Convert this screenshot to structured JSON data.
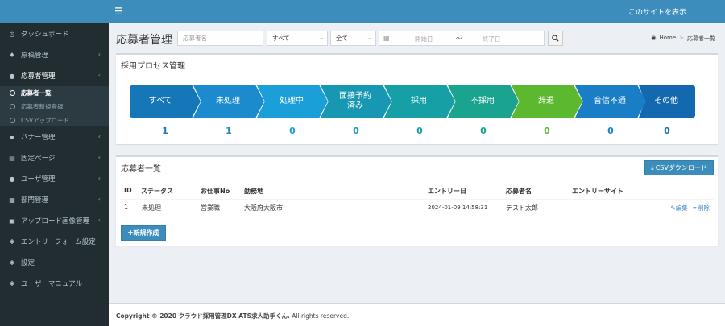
{
  "header": {
    "menu_icon": "hamburger-icon",
    "site_link": "このサイトを表示"
  },
  "sidebar": {
    "items": [
      {
        "label": "ダッシュボード",
        "icon": "dashboard-icon",
        "glyph": "◷",
        "chev": ""
      },
      {
        "label": "原稿管理",
        "icon": "pin-icon",
        "glyph": "♦",
        "chev": "‹"
      },
      {
        "label": "応募者管理",
        "icon": "users-icon",
        "glyph": "●",
        "chev": "‹"
      },
      {
        "label": "バナー管理",
        "icon": "image-icon",
        "glyph": "▪",
        "chev": "‹"
      },
      {
        "label": "固定ページ",
        "icon": "file-icon",
        "glyph": "▤",
        "chev": "‹"
      },
      {
        "label": "ユーザ管理",
        "icon": "user-group-icon",
        "glyph": "●",
        "chev": "‹"
      },
      {
        "label": "部門管理",
        "icon": "building-icon",
        "glyph": "▦",
        "chev": "‹"
      },
      {
        "label": "アップロード画像管理",
        "icon": "picture-icon",
        "glyph": "▣",
        "chev": "‹"
      },
      {
        "label": "エントリーフォーム設定",
        "icon": "gear-icon",
        "glyph": "✱",
        "chev": ""
      },
      {
        "label": "設定",
        "icon": "gear-icon",
        "glyph": "✱",
        "chev": ""
      },
      {
        "label": "ユーザーマニュアル",
        "icon": "gear-icon",
        "glyph": "✱",
        "chev": ""
      }
    ],
    "subitems": [
      {
        "label": "応募者一覧",
        "active": true
      },
      {
        "label": "応募者新規登録",
        "active": false
      },
      {
        "label": "CSVアップロード",
        "active": false
      }
    ]
  },
  "page": {
    "title": "応募者管理"
  },
  "filters": {
    "name_placeholder": "応募者名",
    "status_select": "すべて",
    "site_select": "全て",
    "date_start_placeholder": "開始日",
    "date_separator": "〜",
    "date_end_placeholder": "終了日",
    "search_icon": "search-icon"
  },
  "breadcrumb": {
    "home": "Home",
    "current": "応募者一覧",
    "separator": ">"
  },
  "process": {
    "title": "採用プロセス管理",
    "steps": [
      {
        "label": "すべて",
        "count": "1",
        "color": "#1577b8"
      },
      {
        "label": "未処理",
        "count": "1",
        "color": "#1b8bcd"
      },
      {
        "label": "処理中",
        "count": "0",
        "color": "#1a9fd9"
      },
      {
        "label": "面接予約済み",
        "count": "0",
        "color": "#1897b2"
      },
      {
        "label": "採用",
        "count": "0",
        "color": "#16a0a6"
      },
      {
        "label": "不採用",
        "count": "0",
        "color": "#1aa38e"
      },
      {
        "label": "辞退",
        "count": "0",
        "color": "#5cb82e"
      },
      {
        "label": "音信不通",
        "count": "0",
        "color": "#1a7ec6"
      },
      {
        "label": "その他",
        "count": "0",
        "color": "#1468b0"
      }
    ]
  },
  "list": {
    "title": "応募者一覧",
    "csv_button": "CSVダウンロード",
    "columns": [
      "ID",
      "ステータス",
      "お仕事No",
      "勤務地",
      "エントリー日",
      "応募者名",
      "エントリーサイト"
    ],
    "rows": [
      {
        "id": "1",
        "status": "未処理",
        "job_no": "営業職",
        "location": "大阪府大阪市",
        "entry_date": "2024-01-09 14:58:31",
        "name": "テスト太郎",
        "site": "",
        "edit": "編集",
        "delete": "削除"
      }
    ],
    "new_button": "新規作成"
  },
  "footer": {
    "copyright": "Copyright © 2020 クラウド採用管理DX ATS求人助手くん.",
    "rights": " All rights reserved."
  }
}
